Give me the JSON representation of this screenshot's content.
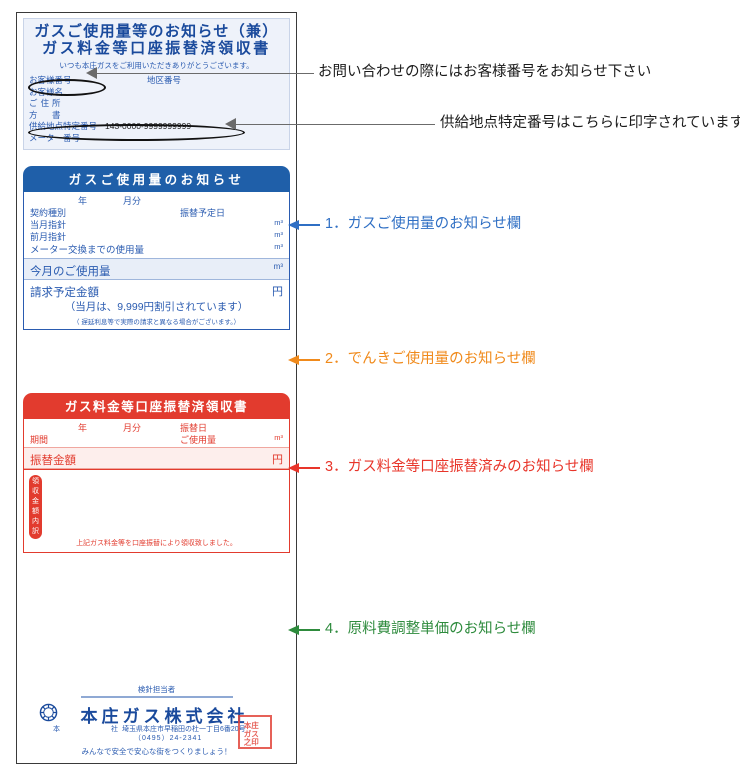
{
  "document": {
    "header": {
      "title_line1": "ガスご使用量等のお知らせ（兼）",
      "title_line2": "ガス料金等口座振替済領収書",
      "thanks": "いつも本庄ガスをご利用いただきありがとうございます。",
      "fields": {
        "customer_number": "お客様番号",
        "district_number": "地区番号",
        "customer_name": "お客様名",
        "address": "ご住所",
        "building": "方　書",
        "supply_point_label": "供給地点特定番号",
        "supply_point_value": "143-0000-9999999999",
        "meter_number": "メーター番号"
      }
    },
    "gas_usage": {
      "bar_title": "ガスご使用量のお知らせ",
      "year": "年",
      "month": "月分",
      "contract_type": "契約種別",
      "transfer_due_date": "振替予定日",
      "current_reading": "当月指針",
      "previous_reading": "前月指針",
      "usage_until_meter_change": "メーター交換までの使用量",
      "unit_m3": "m³",
      "this_month_usage": "今月のご使用量",
      "billed_amount": "請求予定金額",
      "unit_yen": "円",
      "discount_note": "（当月は、9,999円割引されています）",
      "small_note": "（ 遅延利息等で実際の請求と異なる場合がございます。）"
    },
    "receipt": {
      "bar_title": "ガス料金等口座振替済領収書",
      "year": "年",
      "month": "月分",
      "transfer_date": "振替日",
      "period": "期間",
      "usage": "ご使用量",
      "unit_m3": "m³",
      "transfer_amount": "振替金額",
      "unit_yen": "円",
      "breakdown_tab": "領収金額内訳",
      "confirmation": "上記ガス料金等を口座振替により領収致しました。"
    },
    "footer": {
      "meter_person": "検針担当者",
      "company_name": "本庄ガス株式会社",
      "head_office_label": "本　社",
      "address": "埼玉県本庄市早稲田の杜一丁目6番20号",
      "phone": "（0495）24-2341",
      "slogan": "みんなで安全で安心な街をつくりましょう！",
      "seal_text": "本庄ガス株式会社之印"
    }
  },
  "callouts": {
    "top": [
      {
        "text": "お問い合わせの際にはお客様番号をお知らせ下さい"
      },
      {
        "text": "供給地点特定番号はこちらに印字されています"
      }
    ],
    "numbered": [
      {
        "text": "1．ガスご使用量のお知らせ欄",
        "color": "#2f6fc4"
      },
      {
        "text": "2．でんきご使用量のお知らせ欄",
        "color": "#f08a1b"
      },
      {
        "text": "3．ガス料金等口座振替済みのお知らせ欄",
        "color": "#e8352a"
      },
      {
        "text": "4．原料費調整単価のお知らせ欄",
        "color": "#2e8b3d"
      }
    ]
  },
  "colors": {
    "blue": "#1f5fa9",
    "red": "#e23b2e",
    "orange": "#f08a1b",
    "green": "#2e8b3d"
  }
}
